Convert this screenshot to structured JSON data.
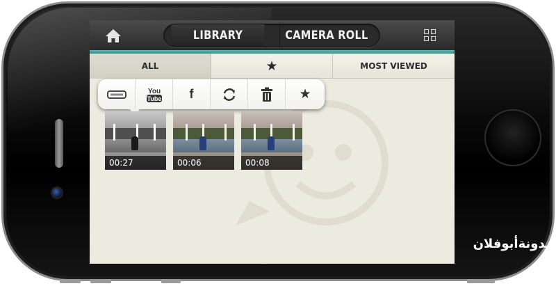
{
  "header": {
    "home_icon": "home-icon",
    "segments": [
      "LIBRARY",
      "CAMERA ROLL"
    ],
    "selected_segment": "LIBRARY",
    "view_icon": "grid-icon",
    "accent": "#5aa9a6"
  },
  "filter_tabs": {
    "all": "ALL",
    "favorites_icon": "★",
    "most_viewed": "MOST VIEWED",
    "selected": "ALL"
  },
  "popover_actions": [
    {
      "name": "share-icon",
      "glyph": ""
    },
    {
      "name": "youtube-icon",
      "glyph": "You\nTube"
    },
    {
      "name": "facebook-icon",
      "glyph": "f"
    },
    {
      "name": "refresh-icon",
      "glyph": "⟳"
    },
    {
      "name": "trash-icon",
      "glyph": ""
    },
    {
      "name": "star-icon",
      "glyph": "★"
    }
  ],
  "videos": [
    {
      "duration": "00:27",
      "style": "bw"
    },
    {
      "duration": "00:06",
      "style": "color"
    },
    {
      "duration": "00:08",
      "style": "color"
    }
  ],
  "watermark_text": "مدونةأبوفلان"
}
